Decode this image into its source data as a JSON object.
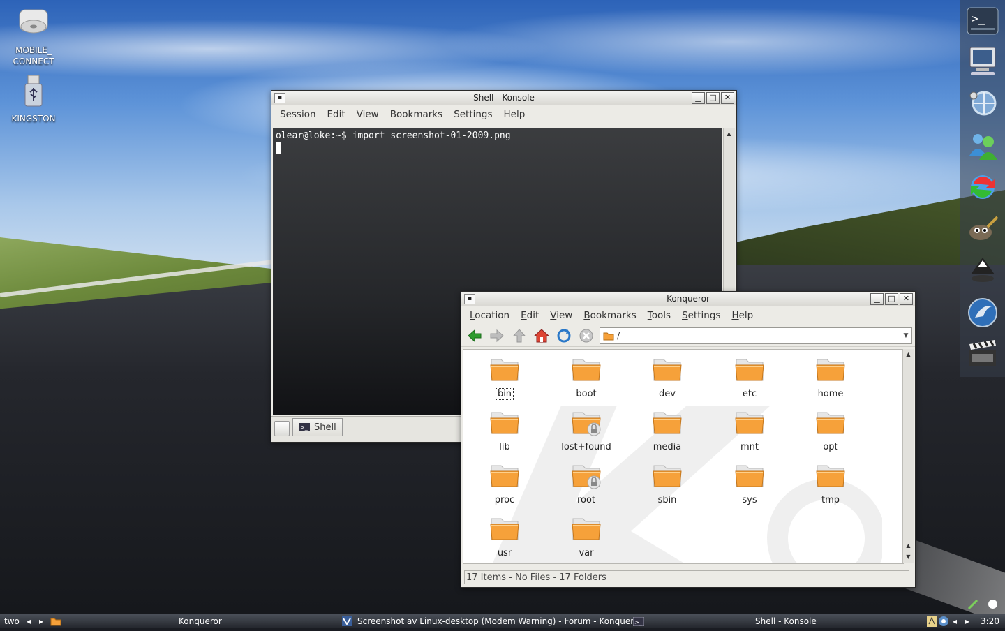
{
  "desktop": {
    "icons": [
      {
        "label": "MOBILE_\nCONNECT",
        "line1": "MOBILE_",
        "line2": "CONNECT",
        "icon": "drive-icon"
      },
      {
        "label": "KINGSTON",
        "icon": "usb-drive-icon"
      }
    ]
  },
  "dock": {
    "items": [
      "terminal-icon",
      "computer-icon",
      "network-icon",
      "messenger-icon",
      "update-icon",
      "gimp-icon",
      "inkscape-icon",
      "music-player-icon",
      "video-editor-icon"
    ]
  },
  "konsole": {
    "title": "Shell - Konsole",
    "menu": [
      "Session",
      "Edit",
      "View",
      "Bookmarks",
      "Settings",
      "Help"
    ],
    "terminal_line": "olear@loke:~$ import screenshot-01-2009.png",
    "tab_label": "Shell"
  },
  "konqueror": {
    "title": "Konqueror",
    "menu": [
      "Location",
      "Edit",
      "View",
      "Bookmarks",
      "Tools",
      "Settings",
      "Help"
    ],
    "location": "/",
    "folders": [
      "bin",
      "boot",
      "dev",
      "etc",
      "home",
      "lib",
      "lost+found",
      "media",
      "mnt",
      "opt",
      "proc",
      "root",
      "sbin",
      "sys",
      "tmp",
      "usr",
      "var"
    ],
    "locked": [
      "lost+found",
      "root"
    ],
    "status": "17 Items - No Files - 17 Folders"
  },
  "taskbar": {
    "desktop_name": "two",
    "tasks": [
      "Konqueror",
      "Screenshot av Linux-desktop (Modem Warning) - Forum - Konqueror",
      "Shell - Konsole"
    ],
    "clock": "3:20"
  },
  "colors": {
    "folder": "#f6a13a",
    "titlebar": "#dcdbd6",
    "taskbar": "#2e3238"
  }
}
